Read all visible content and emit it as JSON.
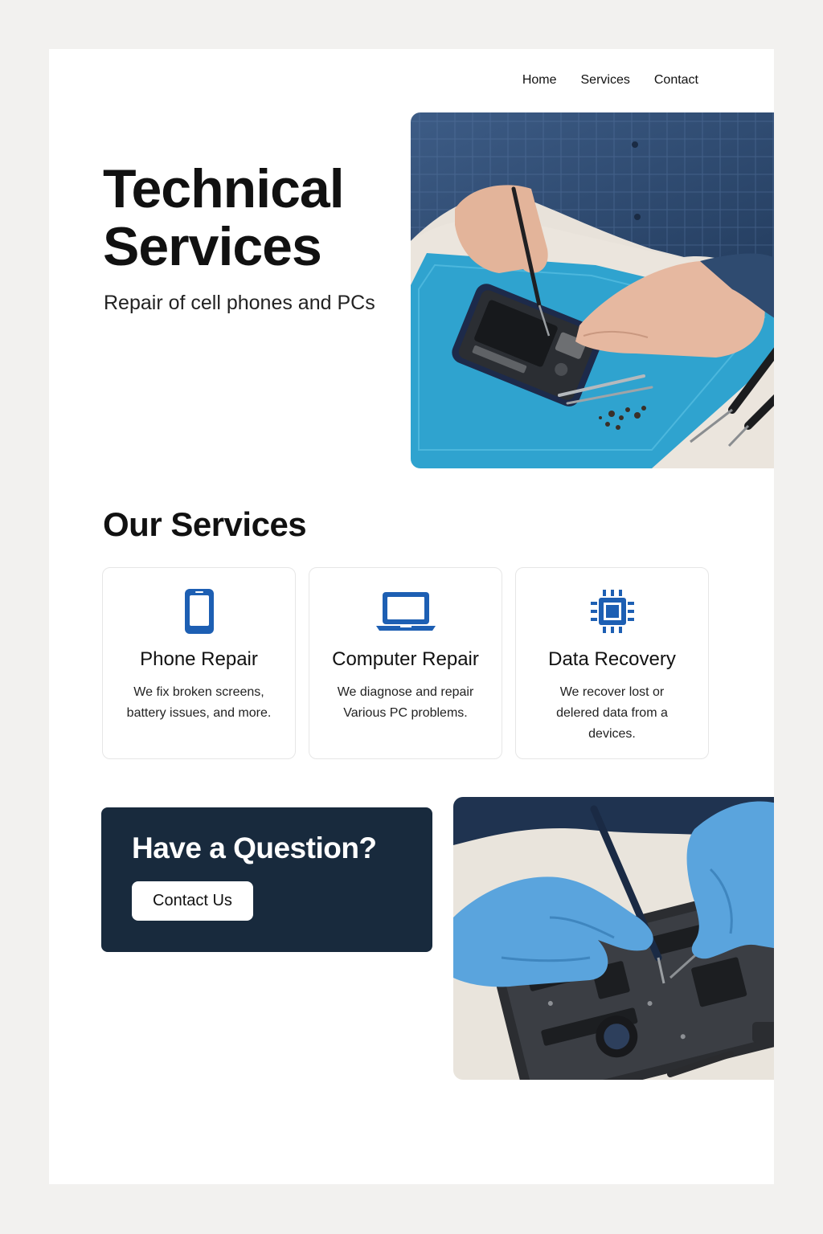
{
  "nav": {
    "items": [
      "Home",
      "Services",
      "Contact"
    ]
  },
  "hero": {
    "title_line1": "Technical",
    "title_line2": "Services",
    "subtitle": "Repair of cell phones and PCs"
  },
  "services": {
    "heading": "Our Services",
    "cards": [
      {
        "icon": "phone-icon",
        "title": "Phone Repair",
        "text_line1": "We fix broken screens,",
        "text_line2": "battery issues, and more."
      },
      {
        "icon": "laptop-icon",
        "title": "Computer Repair",
        "text_line1": "We diagnose and repair",
        "text_line2": "Various PC problems."
      },
      {
        "icon": "chip-icon",
        "title": "Data Recovery",
        "text_line1": "We recover lost or",
        "text_line2": "delered data from a",
        "text_line3": "devices."
      }
    ]
  },
  "cta": {
    "title": "Have a Question?",
    "button_label": "Contact Us"
  },
  "colors": {
    "accent": "#1d5fb3",
    "cta_bg": "#182a3d",
    "mat_blue": "#2fa3cf"
  }
}
